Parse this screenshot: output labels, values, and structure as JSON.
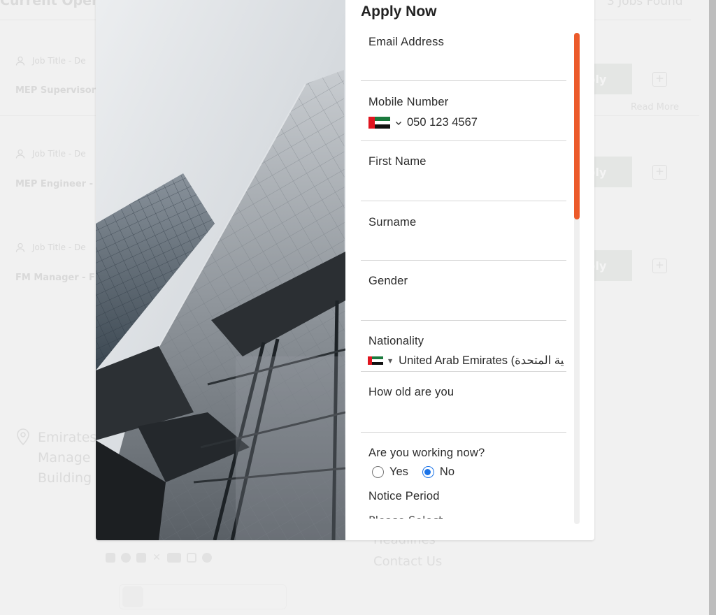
{
  "background_page": {
    "section_title": "Current Openi",
    "jobs_found": "3 Jobs Found",
    "jobs": [
      {
        "meta_label": "Job Title - De",
        "title": "MEP Supervisor",
        "apply_label": "ply",
        "plus_icon": "plus-square-icon"
      },
      {
        "meta_label": "Job Title - De",
        "title": "MEP Engineer - ",
        "apply_label": "ply",
        "plus_icon": "plus-square-icon"
      },
      {
        "meta_label": "Job Title - De",
        "title": "FM Manager - F",
        "apply_label": "ply",
        "plus_icon": "plus-square-icon"
      }
    ],
    "read_more": "Read More",
    "address_lines": [
      "Emirates",
      "Manage",
      "Building"
    ],
    "footer_links": [
      "Headlines",
      "Contact Us"
    ],
    "social_icons": [
      "tiktok-icon",
      "facebook-icon",
      "linkedin-icon",
      "x-icon",
      "youtube-icon",
      "instagram-icon",
      "whatsapp-icon"
    ]
  },
  "modal": {
    "title": "Apply Now",
    "image_description": "Glass skyscrapers against a cloudy sky",
    "fields": {
      "email": {
        "label": "Email Address",
        "value": ""
      },
      "mobile": {
        "label": "Mobile Number",
        "country": "United Arab Emirates",
        "flag_icon": "uae-flag-icon",
        "value": "050 123 4567"
      },
      "first_name": {
        "label": "First Name",
        "value": ""
      },
      "surname": {
        "label": "Surname",
        "value": ""
      },
      "gender": {
        "label": "Gender",
        "value": ""
      },
      "nationality": {
        "label": "Nationality",
        "flag_icon": "uae-flag-icon",
        "value": "United Arab Emirates (الإمارات العربية المتحدة)"
      },
      "age": {
        "label": "How old are you",
        "value": ""
      },
      "working_now": {
        "label": "Are you working now?",
        "options": [
          "Yes",
          "No"
        ],
        "selected": "No"
      },
      "notice_period": {
        "label": "Notice Period",
        "placeholder": "Please Select"
      }
    },
    "scrollbar": {
      "position_fraction": 0.0,
      "visible_fraction": 0.38,
      "thumb_color": "#ec5a2a"
    }
  },
  "colors": {
    "accent": "#ec5a2a",
    "radio_selected": "#1a73e8",
    "uae_red": "#e0151f",
    "uae_green": "#1b7a3d"
  }
}
